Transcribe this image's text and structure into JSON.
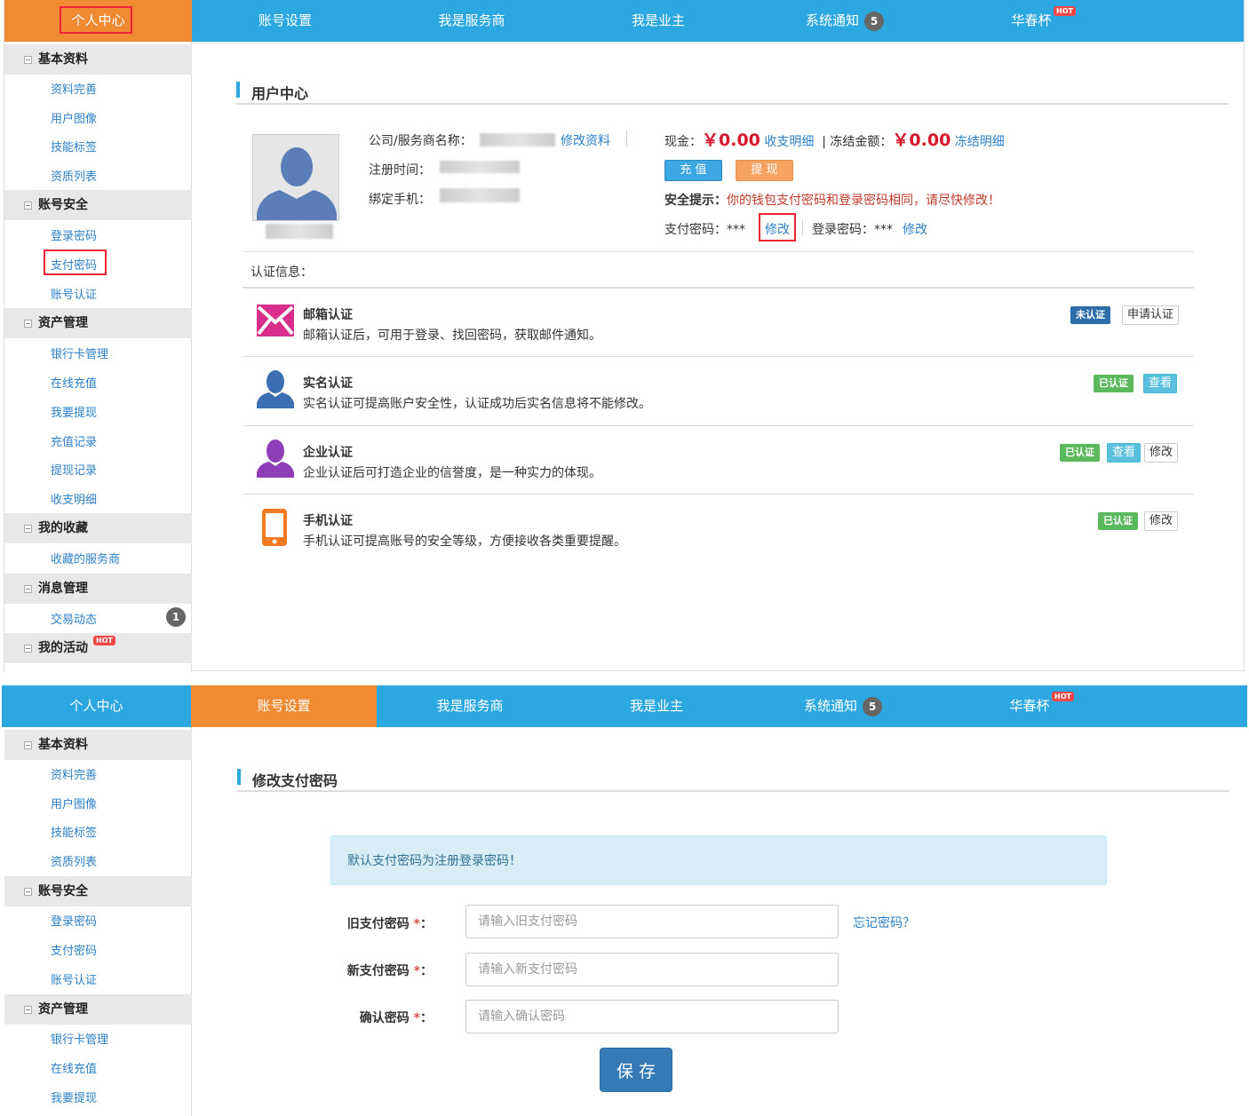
{
  "nav": {
    "items": [
      "个人中心",
      "账号设置",
      "我是服务商",
      "我是业主",
      "系统通知",
      "华春杯"
    ],
    "notify_count": "5",
    "hot": "HOT"
  },
  "sidebar1": {
    "g1": "基本资料",
    "g1_items": [
      "资料完善",
      "用户图像",
      "技能标签",
      "资质列表"
    ],
    "g2": "账号安全",
    "g2_items": [
      "登录密码",
      "支付密码",
      "账号认证"
    ],
    "g3": "资产管理",
    "g3_items": [
      "银行卡管理",
      "在线充值",
      "我要提现",
      "充值记录",
      "提现记录",
      "收支明细"
    ],
    "g4": "我的收藏",
    "g4_items": [
      "收藏的服务商"
    ],
    "g5": "消息管理",
    "g5_items": [
      "交易动态"
    ],
    "msg_count": "1",
    "g6": "我的活动"
  },
  "usercenter": {
    "title": "用户中心",
    "company_label": "公司/服务商名称：",
    "edit_profile": "修改资料",
    "reg_label": "注册时间：",
    "phone_label": "绑定手机：",
    "cash_label": "现金：",
    "cash_value": "￥0.00",
    "cash_link": "收支明细",
    "frozen_label": "冻结金额：",
    "frozen_value": "￥0.00",
    "frozen_link": "冻结明细",
    "recharge_btn": "充 值",
    "withdraw_btn": "提 现",
    "security_label": "安全提示：",
    "security_msg": "你的钱包支付密码和登录密码相同，请尽快修改！",
    "paypwd_label": "支付密码：***",
    "paypwd_edit": "修改",
    "loginpwd_label": "登录密码：***",
    "loginpwd_edit": "修改",
    "cert_header": "认证信息："
  },
  "certs": [
    {
      "title": "邮箱认证",
      "desc": "邮箱认证后，可用于登录、找回密码，获取邮件通知。",
      "status": "未认证",
      "actions": [
        "申请认证"
      ]
    },
    {
      "title": "实名认证",
      "desc": "实名认证可提高账户安全性，认证成功后实名信息将不能修改。",
      "status": "已认证",
      "actions": [
        "查看"
      ]
    },
    {
      "title": "企业认证",
      "desc": "企业认证后可打造企业的信誉度，是一种实力的体现。",
      "status": "已认证",
      "actions": [
        "查看",
        "修改"
      ]
    },
    {
      "title": "手机认证",
      "desc": "手机认证可提高账号的安全等级，方便接收各类重要提醒。",
      "status": "已认证",
      "actions": [
        "修改"
      ]
    }
  ],
  "sidebar2": {
    "g1": "基本资料",
    "g1_items": [
      "资料完善",
      "用户图像",
      "技能标签",
      "资质列表"
    ],
    "g2": "账号安全",
    "g2_items": [
      "登录密码",
      "支付密码",
      "账号认证"
    ],
    "g3": "资产管理",
    "g3_items": [
      "银行卡管理",
      "在线充值",
      "我要提现"
    ]
  },
  "paypwd": {
    "title": "修改支付密码",
    "alert": "默认支付密码为注册登录密码！",
    "old_label": "旧支付密码",
    "old_placeholder": "请输入旧支付密码",
    "forgot": "忘记密码？",
    "new_label": "新支付密码",
    "new_placeholder": "请输入新支付密码",
    "confirm_label": "确认密码",
    "confirm_placeholder": "请输入确认密码",
    "star": "*",
    "colon": "：",
    "save": "保 存"
  },
  "colors": {
    "nav_blue": "#2ca7e0",
    "nav_active": "#f08a33",
    "money_red": "#d8162e",
    "link_blue": "#2c7fc6"
  }
}
